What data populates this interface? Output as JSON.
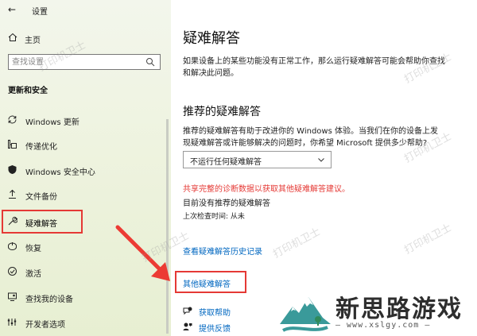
{
  "window": {
    "title": "设置"
  },
  "sidebar": {
    "home_label": "主页",
    "search_placeholder": "查找设置",
    "section_header": "更新和安全",
    "items": [
      {
        "label": "Windows 更新",
        "icon": "sync-icon"
      },
      {
        "label": "传递优化",
        "icon": "delivery-optimization-icon"
      },
      {
        "label": "Windows 安全中心",
        "icon": "shield-icon"
      },
      {
        "label": "文件备份",
        "icon": "backup-icon"
      },
      {
        "label": "疑难解答",
        "icon": "wrench-icon",
        "selected": true
      },
      {
        "label": "恢复",
        "icon": "recovery-icon"
      },
      {
        "label": "激活",
        "icon": "activation-icon"
      },
      {
        "label": "查找我的设备",
        "icon": "find-device-icon"
      },
      {
        "label": "开发者选项",
        "icon": "developer-icon"
      }
    ]
  },
  "main": {
    "title": "疑难解答",
    "description": "如果设备上的某些功能没有正常工作，那么运行疑难解答可能会帮助你查找和解决此问题。",
    "recommended_title": "推荐的疑难解答",
    "recommended_desc": "推荐的疑难解答有助于改进你的 Windows 体验。当我们在你的设备上发现疑难解答或许能够解决的问题时，你希望 Microsoft 提供多少帮助?",
    "dropdown_value": "不运行任何疑难解答",
    "share_link": "共享完整的诊断数据以获取其他疑难解答建议。",
    "no_recommended": "目前没有推荐的疑难解答",
    "last_check": "上次检查时间: 从未",
    "history_link": "查看疑难解答历史记录",
    "other_link": "其他疑难解答",
    "get_help": "获取帮助",
    "feedback": "提供反馈"
  },
  "watermark": "打印机卫士",
  "brand": {
    "name": "新思路游戏",
    "url": "— www.xslgy.com —"
  },
  "colors": {
    "highlight": "#e53935",
    "link": "#0067c0",
    "sidebar_bg": "#eef3df"
  }
}
